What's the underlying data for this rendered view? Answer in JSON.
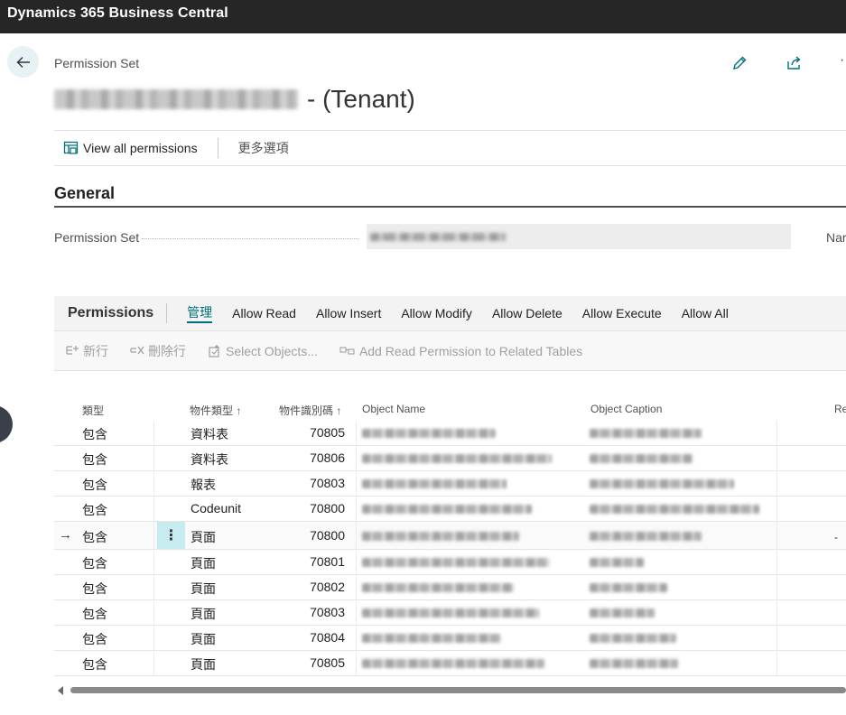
{
  "app": {
    "title": "Dynamics 365 Business Central"
  },
  "page": {
    "breadcrumb": "Permission Set",
    "title_suffix": "- (Tenant)"
  },
  "actions": {
    "view_all": "View all permissions",
    "more_options": "更多選項"
  },
  "general": {
    "section_title": "General",
    "permission_set_label": "Permission Set",
    "name_label": "Nar"
  },
  "permissions": {
    "title": "Permissions",
    "tabs": [
      "管理",
      "Allow Read",
      "Allow Insert",
      "Allow Modify",
      "Allow Delete",
      "Allow Execute",
      "Allow All"
    ],
    "subactions": [
      "新行",
      "刪除行",
      "Select Objects...",
      "Add Read Permission to Related Tables"
    ],
    "columns": {
      "type": "類型",
      "object_type": "物件類型 ↑",
      "object_id": "物件識別碼 ↑",
      "object_name": "Object Name",
      "object_caption": "Object Caption",
      "extra": "Re"
    },
    "rows": [
      {
        "type": "包含",
        "object_type": "資料表",
        "object_id": "70805"
      },
      {
        "type": "包含",
        "object_type": "資料表",
        "object_id": "70806"
      },
      {
        "type": "包含",
        "object_type": "報表",
        "object_id": "70803"
      },
      {
        "type": "包含",
        "object_type": "Codeunit",
        "object_id": "70800"
      },
      {
        "type": "包含",
        "object_type": "頁面",
        "object_id": "70800",
        "extra": "-"
      },
      {
        "type": "包含",
        "object_type": "頁面",
        "object_id": "70801"
      },
      {
        "type": "包含",
        "object_type": "頁面",
        "object_id": "70802"
      },
      {
        "type": "包含",
        "object_type": "頁面",
        "object_id": "70803"
      },
      {
        "type": "包含",
        "object_type": "頁面",
        "object_id": "70804"
      },
      {
        "type": "包含",
        "object_type": "頁面",
        "object_id": "70805"
      }
    ]
  },
  "colors": {
    "accent": "#00707a",
    "topbar": "#262626",
    "selected_cell": "#c6ecef"
  }
}
